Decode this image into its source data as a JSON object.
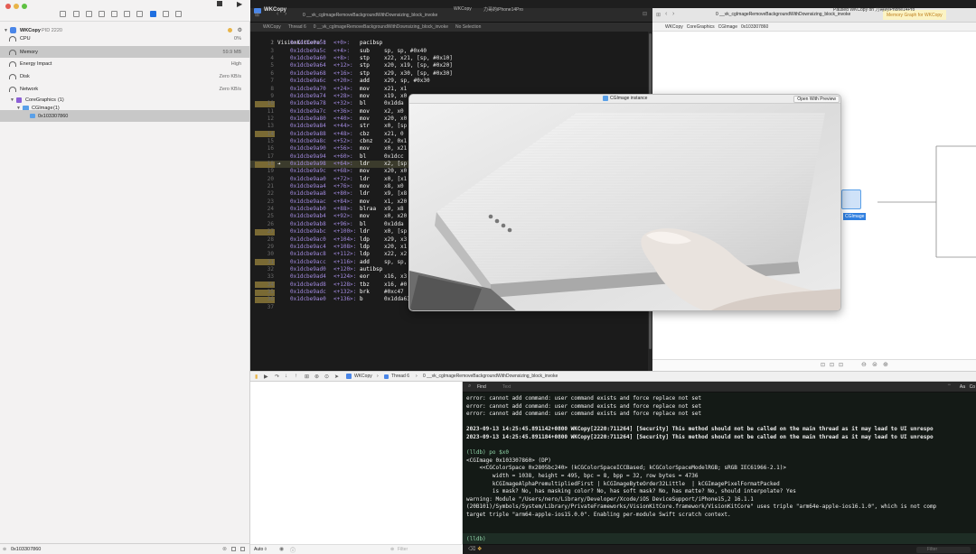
{
  "window": {
    "app_title": "WKCopy",
    "top_right_status": "Paused WKCopy on 力哥的iPhone14Pro"
  },
  "navigator": {
    "process_name": "WKCopy",
    "process_pid": "PID 2220",
    "gauges": [
      {
        "label": "CPU",
        "value": "0%"
      },
      {
        "label": "Memory",
        "value": "59.9 MB"
      },
      {
        "label": "Energy Impact",
        "value": "High"
      },
      {
        "label": "Disk",
        "value": "Zero KB/s"
      },
      {
        "label": "Network",
        "value": "Zero KB/s"
      }
    ],
    "tree": [
      {
        "label": "CoreGraphics",
        "count": "(1)"
      },
      {
        "label": "CGImage",
        "count": "(1)"
      },
      {
        "label": "0x103307860",
        "count": ""
      }
    ],
    "filter_value": "0x103307860"
  },
  "editor": {
    "tabs": [
      "WKCopy",
      "力哥的iPhone14Pro"
    ],
    "file_tab": "0 __vk_cgImageRemoveBackgroundWithDownsizing_block_invoke",
    "jumpbar": [
      "WKCopy",
      "Thread 6",
      "0 __vk_cgImageRemoveBackgroundWithDownsizing_block_invoke",
      "No Selection"
    ],
    "first_line": "VisionKitCore`:",
    "lines": [
      {
        "n": "2",
        "addr": "0x1dcbe9a58",
        "off": "<+0>:",
        "op": "pacibsp",
        "args": "",
        "bp": false
      },
      {
        "n": "3",
        "addr": "0x1dcbe9a5c",
        "off": "<+4>:",
        "op": "sub",
        "args": "sp, sp, #0x40",
        "bp": false
      },
      {
        "n": "4",
        "addr": "0x1dcbe9a60",
        "off": "<+8>:",
        "op": "stp",
        "args": "x22, x21, [sp, #0x10]",
        "bp": false
      },
      {
        "n": "5",
        "addr": "0x1dcbe9a64",
        "off": "<+12>:",
        "op": "stp",
        "args": "x20, x19, [sp, #0x20]",
        "bp": false
      },
      {
        "n": "6",
        "addr": "0x1dcbe9a68",
        "off": "<+16>:",
        "op": "stp",
        "args": "x29, x30, [sp, #0x30]",
        "bp": false
      },
      {
        "n": "7",
        "addr": "0x1dcbe9a6c",
        "off": "<+20>:",
        "op": "add",
        "args": "x29, sp, #0x30",
        "bp": false
      },
      {
        "n": "8",
        "addr": "0x1dcbe9a70",
        "off": "<+24>:",
        "op": "mov",
        "args": "x21, x1",
        "bp": false
      },
      {
        "n": "9",
        "addr": "0x1dcbe9a74",
        "off": "<+28>:",
        "op": "mov",
        "args": "x19, x0",
        "bp": false
      },
      {
        "n": "10",
        "addr": "0x1dcbe9a78",
        "off": "<+32>:",
        "op": "bl",
        "args": "0x1dda",
        "bp": true
      },
      {
        "n": "11",
        "addr": "0x1dcbe9a7c",
        "off": "<+36>:",
        "op": "mov",
        "args": "x2, x0",
        "bp": false
      },
      {
        "n": "12",
        "addr": "0x1dcbe9a80",
        "off": "<+40>:",
        "op": "mov",
        "args": "x20, x0",
        "bp": false
      },
      {
        "n": "13",
        "addr": "0x1dcbe9a84",
        "off": "<+44>:",
        "op": "str",
        "args": "x0, [sp",
        "bp": false
      },
      {
        "n": "14",
        "addr": "0x1dcbe9a88",
        "off": "<+48>:",
        "op": "cbz",
        "args": "x21, 0",
        "bp": true
      },
      {
        "n": "15",
        "addr": "0x1dcbe9a8c",
        "off": "<+52>:",
        "op": "cbnz",
        "args": "x2, 0x1",
        "bp": false
      },
      {
        "n": "16",
        "addr": "0x1dcbe9a90",
        "off": "<+56>:",
        "op": "mov",
        "args": "x0, x21",
        "bp": false
      },
      {
        "n": "17",
        "addr": "0x1dcbe9a94",
        "off": "<+60>:",
        "op": "bl",
        "args": "0x1dcc",
        "bp": false
      },
      {
        "n": "18",
        "addr": "0x1dcbe9a98",
        "off": "<+64>:",
        "op": "ldr",
        "args": "x2, [sp",
        "bp": true,
        "current": true
      },
      {
        "n": "19",
        "addr": "0x1dcbe9a9c",
        "off": "<+68>:",
        "op": "mov",
        "args": "x20, x0",
        "bp": false
      },
      {
        "n": "20",
        "addr": "0x1dcbe9aa0",
        "off": "<+72>:",
        "op": "ldr",
        "args": "x0, [x1",
        "bp": false
      },
      {
        "n": "21",
        "addr": "0x1dcbe9aa4",
        "off": "<+76>:",
        "op": "mov",
        "args": "x8, x0",
        "bp": false
      },
      {
        "n": "22",
        "addr": "0x1dcbe9aa8",
        "off": "<+80>:",
        "op": "ldr",
        "args": "x9, [x8",
        "bp": false
      },
      {
        "n": "23",
        "addr": "0x1dcbe9aac",
        "off": "<+84>:",
        "op": "mov",
        "args": "x1, x20",
        "bp": false
      },
      {
        "n": "24",
        "addr": "0x1dcbe9ab0",
        "off": "<+88>:",
        "op": "blraa",
        "args": "x9, x8",
        "bp": false
      },
      {
        "n": "25",
        "addr": "0x1dcbe9ab4",
        "off": "<+92>:",
        "op": "mov",
        "args": "x0, x20",
        "bp": false
      },
      {
        "n": "26",
        "addr": "0x1dcbe9ab8",
        "off": "<+96>:",
        "op": "bl",
        "args": "0x1dda",
        "bp": false
      },
      {
        "n": "27",
        "addr": "0x1dcbe9abc",
        "off": "<+100>:",
        "op": "ldr",
        "args": "x0, [sp",
        "bp": true
      },
      {
        "n": "28",
        "addr": "0x1dcbe9ac0",
        "off": "<+104>:",
        "op": "ldp",
        "args": "x29, x3",
        "bp": false
      },
      {
        "n": "29",
        "addr": "0x1dcbe9ac4",
        "off": "<+108>:",
        "op": "ldp",
        "args": "x20, x1",
        "bp": false
      },
      {
        "n": "30",
        "addr": "0x1dcbe9ac8",
        "off": "<+112>:",
        "op": "ldp",
        "args": "x22, x2",
        "bp": false
      },
      {
        "n": "31",
        "addr": "0x1dcbe9acc",
        "off": "<+116>:",
        "op": "add",
        "args": "sp, sp,",
        "bp": true
      },
      {
        "n": "32",
        "addr": "0x1dcbe9ad0",
        "off": "<+120>:",
        "op": "autibsp",
        "args": "",
        "bp": false
      },
      {
        "n": "33",
        "addr": "0x1dcbe9ad4",
        "off": "<+124>:",
        "op": "eor",
        "args": "x16, x3",
        "bp": false
      },
      {
        "n": "34",
        "addr": "0x1dcbe9ad8",
        "off": "<+128>:",
        "op": "tbz",
        "args": "x16, #0",
        "bp": true
      },
      {
        "n": "35",
        "addr": "0x1dcbe9adc",
        "off": "<+132>:",
        "op": "brk",
        "args": "#0xc47",
        "bp": true
      },
      {
        "n": "36",
        "addr": "0x1dcbe9ae0",
        "off": "<+136>:",
        "op": "b",
        "args": "0x1dda630",
        "bp": true
      },
      {
        "n": "37",
        "addr": "",
        "off": "",
        "op": "",
        "args": "",
        "bp": false
      }
    ]
  },
  "assistant": {
    "tabs": [
      "0 __vk_cgImageRemoveBackgroundWithDownsizing_block_invoke",
      "Memory Graph for WKCopy"
    ],
    "jumpbar": [
      "WKCopy",
      "CoreGraphics",
      "CGImage",
      "0x103307860"
    ],
    "node_label": "CGImage"
  },
  "popover": {
    "title": "CGImage instance",
    "open_button": "Open With Preview"
  },
  "debug_bar": {
    "process": "WKCopy",
    "thread": "Thread 6",
    "frame": "0 __vk_cgImageRemoveBackgroundWithDownsizing_block_invoke"
  },
  "variables": {
    "scope": "Auto ◊",
    "filter_placeholder": "Filter"
  },
  "find": {
    "label": "Find",
    "placeholder": "Text",
    "aa": "Aa",
    "contains": "Co"
  },
  "console": {
    "lines": [
      "error: cannot add command: user command exists and force replace not set",
      "error: cannot add command: user command exists and force replace not set",
      "error: cannot add command: user command exists and force replace not set",
      "",
      "2023-09-13 14:25:45.891142+0800 WKCopy[2220:711264] [Security] This method should not be called on the main thread as it may lead to UI unrespo",
      "2023-09-13 14:25:45.891184+0800 WKCopy[2220:711264] [Security] This method should not be called on the main thread as it may lead to UI unrespo",
      "",
      "(lldb) po $x0",
      "<CGImage 0x103307860> (DP)",
      "    <<CGColorSpace 0x2805bc240> (kCGColorSpaceICCBased; kCGColorSpaceModelRGB; sRGB IEC61966-2.1)>",
      "        width = 1038, height = 495, bpc = 8, bpp = 32, row bytes = 4736",
      "        kCGImageAlphaPremultipliedFirst | kCGImageByteOrder32Little  | kCGImagePixelFormatPacked",
      "        is mask? No, has masking color? No, has soft mask? No, has matte? No, should interpolate? Yes",
      "warning: Module \"/Users/nero/Library/Developer/Xcode/iOS DeviceSupport/iPhone15,2 16.1.1",
      "(20B101)/Symbols/System/Library/PrivateFrameworks/VisionKitCore.framework/VisionKitCore\" uses triple \"arm64e-apple-ios16.1.0\", which is not comp",
      "target triple \"arm64-apple-ios15.0.0\". Enabling per-module Swift scratch context."
    ],
    "prompt": "(lldb)",
    "filter_placeholder": "Filter"
  },
  "colors": {
    "accent": "#1f6fe0",
    "breakpoint": "#7a6a34",
    "console_bg": "#141a16",
    "assembly_address": "#a38be0"
  }
}
